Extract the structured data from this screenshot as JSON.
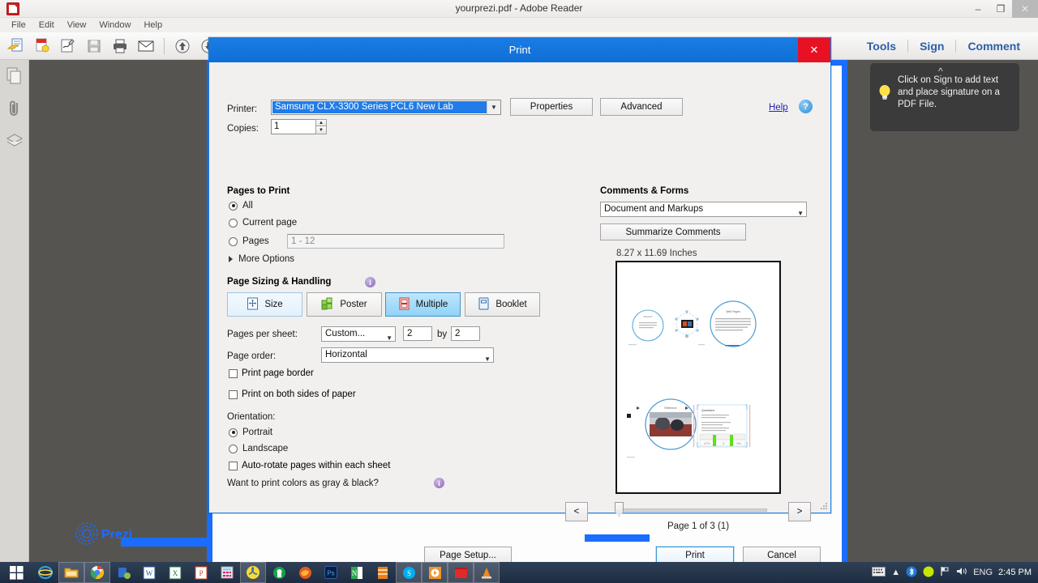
{
  "window": {
    "title": "yourprezi.pdf - Adobe Reader",
    "app_icon": "pdf-icon",
    "minimize": "–",
    "maximize": "❐",
    "close": "✕"
  },
  "menubar": {
    "items": [
      "File",
      "Edit",
      "View",
      "Window",
      "Help"
    ]
  },
  "toolbar": {
    "right_links": [
      "Tools",
      "Sign",
      "Comment"
    ],
    "icons": [
      "open-file-icon",
      "create-pdf-icon",
      "sign-document-icon",
      "save-icon",
      "print-icon",
      "email-icon",
      "previous-page-icon",
      "next-page-icon"
    ]
  },
  "left_rail": {
    "items": [
      "page-thumbnails-icon",
      "attachments-icon",
      "layers-icon"
    ]
  },
  "sign_tooltip": {
    "text": "Click on Sign to add text and place signature on a PDF File.",
    "icon": "lightbulb-icon",
    "caret": "^"
  },
  "document": {
    "watermark": "Prezi"
  },
  "print_dialog": {
    "title": "Print",
    "close_label": "✕",
    "printer": {
      "label": "Printer:",
      "value": "Samsung CLX-3300 Series PCL6 New Lab",
      "properties_label": "Properties",
      "advanced_label": "Advanced",
      "help_label": "Help",
      "help_icon": "help-circle-icon"
    },
    "copies": {
      "label": "Copies:",
      "value": "1"
    },
    "pages_to_print": {
      "heading": "Pages to Print",
      "options": [
        "All",
        "Current page",
        "Pages"
      ],
      "selected": "All",
      "pages_placeholder": "1 - 12",
      "more_options": "More Options"
    },
    "page_sizing": {
      "heading": "Page Sizing & Handling",
      "info_icon": "info-icon",
      "modes": [
        {
          "label": "Size",
          "icon": "size-icon",
          "selected": false
        },
        {
          "label": "Poster",
          "icon": "poster-icon",
          "selected": false
        },
        {
          "label": "Multiple",
          "icon": "multiple-icon",
          "selected": true
        },
        {
          "label": "Booklet",
          "icon": "booklet-icon",
          "selected": false
        }
      ],
      "pages_per_sheet_label": "Pages per sheet:",
      "pages_per_sheet_value": "Custom...",
      "cols": "2",
      "by_label": "by",
      "rows": "2",
      "page_order_label": "Page order:",
      "page_order_value": "Horizontal",
      "print_page_border": {
        "label": "Print page border",
        "checked": false
      },
      "print_both_sides": {
        "label": "Print on both sides of paper",
        "checked": false
      }
    },
    "orientation": {
      "label": "Orientation:",
      "options": [
        "Portrait",
        "Landscape"
      ],
      "selected": "Portrait",
      "auto_rotate": {
        "label": "Auto-rotate pages within each sheet",
        "checked": false
      }
    },
    "gray_black_question": "Want to print colors as gray & black?",
    "gray_black_info_icon": "info-icon",
    "page_setup_label": "Page Setup...",
    "comments_forms": {
      "heading": "Comments & Forms",
      "value": "Document and Markups",
      "summarize_label": "Summarize Comments"
    },
    "preview": {
      "dimensions": "8.27 x 11.69 Inches",
      "page_indicator": "Page 1 of 3 (1)",
      "prev_label": "<",
      "next_label": ">"
    },
    "print_label": "Print",
    "cancel_label": "Cancel"
  },
  "taskbar": {
    "start_icon": "windows-start-icon",
    "items": [
      "internet-explorer-icon",
      "file-explorer-icon",
      "google-chrome-icon",
      "bluestacks-icon",
      "word-icon",
      "excel-icon",
      "powerpoint-icon",
      "calculator-icon",
      "adobe-reader-icon",
      "fastone-icon",
      "firefox-icon",
      "photoshop-icon",
      "onenote-icon",
      "fireworks-icon",
      "skype-icon",
      "vlc-media-icon",
      "pdf-window-icon",
      "cone-icon"
    ],
    "tray": {
      "keyboard_icon": "keyboard-icon",
      "show_hidden_icon": "show-hidden-icons-icon",
      "bluetooth_icon": "bluetooth-icon",
      "antivirus_icon": "antivirus-icon",
      "flag_icon": "action-center-icon",
      "volume_icon": "volume-icon",
      "language": "ENG",
      "clock": "2:45 PM"
    }
  },
  "colors": {
    "dialog_border": "#1c7fe0",
    "title_bar": "#0f6fd6",
    "close_red": "#e81123",
    "selected_segment": "#8fd3f8",
    "link_blue": "#2b5fa8",
    "doc_bg": "#565451"
  }
}
